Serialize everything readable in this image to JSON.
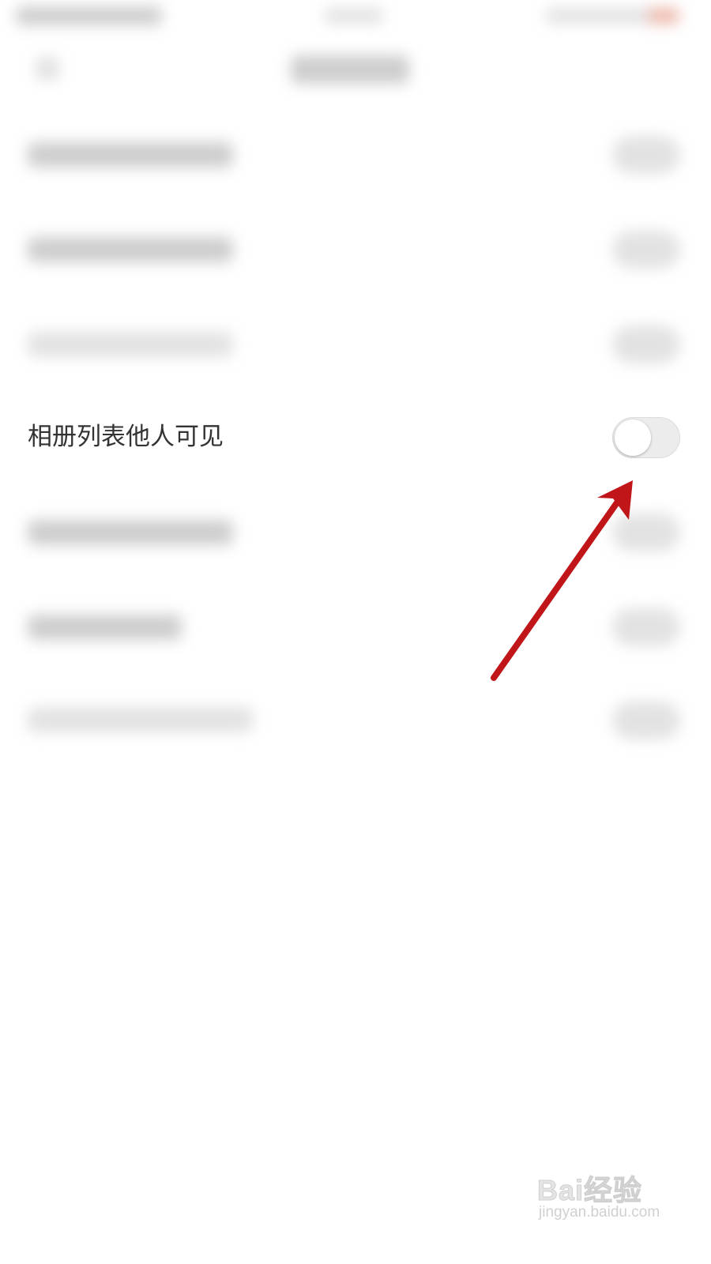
{
  "privacy_settings": {
    "album_list_visible": {
      "label": "相册列表他人可见",
      "enabled": false
    }
  },
  "annotation": {
    "arrow_color": "#c0161a"
  },
  "watermark": {
    "brand": "Bai经验",
    "url": "jingyan.baidu.com"
  },
  "colors": {
    "background": "#ffffff",
    "label_text": "#333333",
    "toggle_off_track": "#ececec",
    "toggle_knob": "#ffffff"
  }
}
